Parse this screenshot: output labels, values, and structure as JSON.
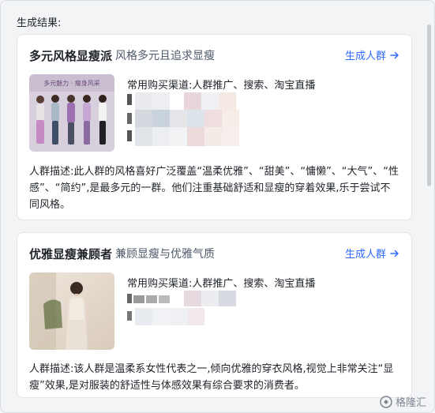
{
  "section_title": "生成结果:",
  "cards": [
    {
      "name": "多元风格显瘦派",
      "subtitle": "风格多元且追求显瘦",
      "action_label": "生成人群",
      "thumb_caption": "多元魅力 · 瘦身风采",
      "channels_label": "常用购买渠道:",
      "channels_value": "人群推广、搜索、淘宝直播",
      "desc_label": "人群描述:",
      "desc_text": "此人群的风格喜好广泛覆盖“温柔优雅”、“甜美”、“慵懒”、“大气”、“性感”、“简约”,是最多元的一群。他们注重基础舒适和显瘦的穿着效果,乐于尝试不同风格。"
    },
    {
      "name": "优雅显瘦兼顾者",
      "subtitle": "兼顾显瘦与优雅气质",
      "action_label": "生成人群",
      "channels_label": "常用购买渠道:",
      "channels_value": "人群推广、搜索、淘宝直播",
      "desc_label": "人群描述:",
      "desc_text": "该人群是温柔系女性代表之一,倾向优雅的穿衣风格,视觉上非常关注“显瘦”效果,是对服装的舒适性与体感效果有综合要求的消费者。"
    }
  ],
  "watermark": "格隆汇",
  "colors": {
    "accent": "#2f6bff",
    "card_bg": "#ffffff",
    "page_bg": "#f3f4f6"
  }
}
